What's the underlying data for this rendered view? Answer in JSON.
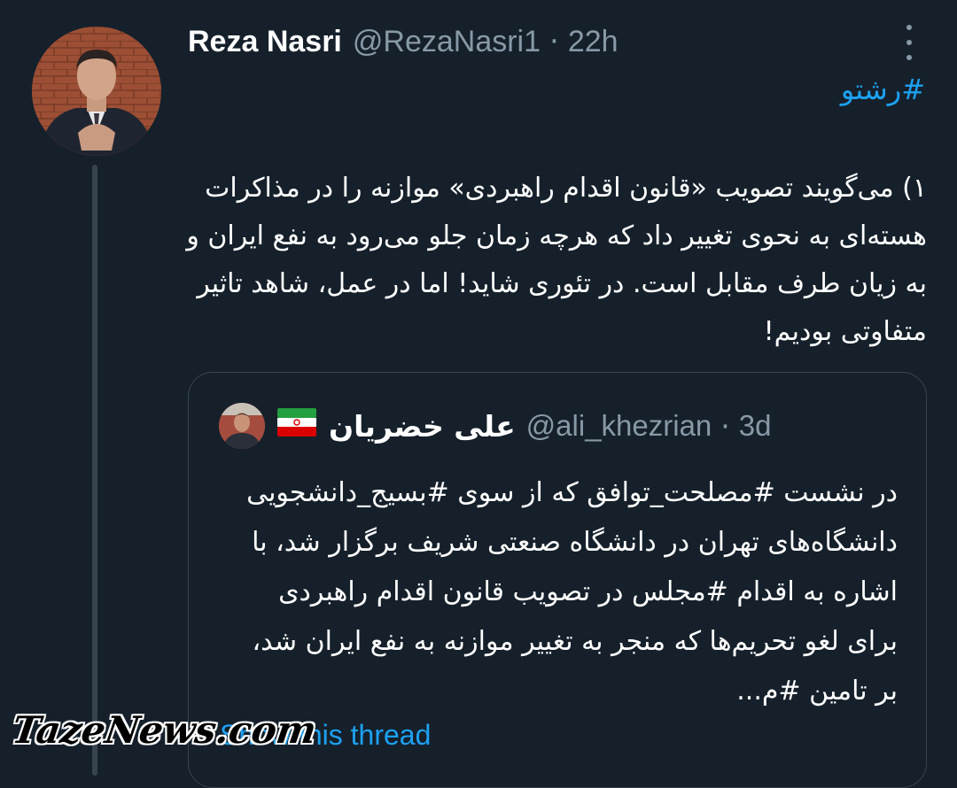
{
  "tweet": {
    "author_name": "Reza Nasri",
    "author_handle": "@RezaNasri1",
    "separator": "·",
    "time": "22h",
    "hashtag": "#رشتو",
    "text": "۱) می‌گویند تصویب «قانون اقدام راهبردی» موازنه را در مذاکرات هسته‌ای به نحوی تغییر داد که هرچه زمان جلو می‌رود به نفع ایران و به زیان طرف مقابل است. در تئوری شاید! اما در عمل، شاهد تاثیر متفاوتی بودیم!"
  },
  "quoted": {
    "author_name": "علی خضریان",
    "author_handle": "@ali_khezrian",
    "separator": "·",
    "time": "3d",
    "flag_icon": "iran-flag-icon",
    "text": "در نشست #مصلحت_توافق که از سوی #بسیج_دانشجویی دانشگاه‌های تهران در دانشگاه صنعتی شریف برگزار شد، با اشاره به اقدام #مجلس در تصویب قانون اقدام راهبردی برای لغو تحریم‌ها که منجر به تغییر موازنه به نفع ایران شد، بر تامین #م..."
  },
  "show_thread_label": "Show this thread",
  "watermark": "TazeNews.com",
  "colors": {
    "background": "#15202b",
    "link": "#1da1f2",
    "muted": "#8899a6",
    "border": "#38444d"
  }
}
